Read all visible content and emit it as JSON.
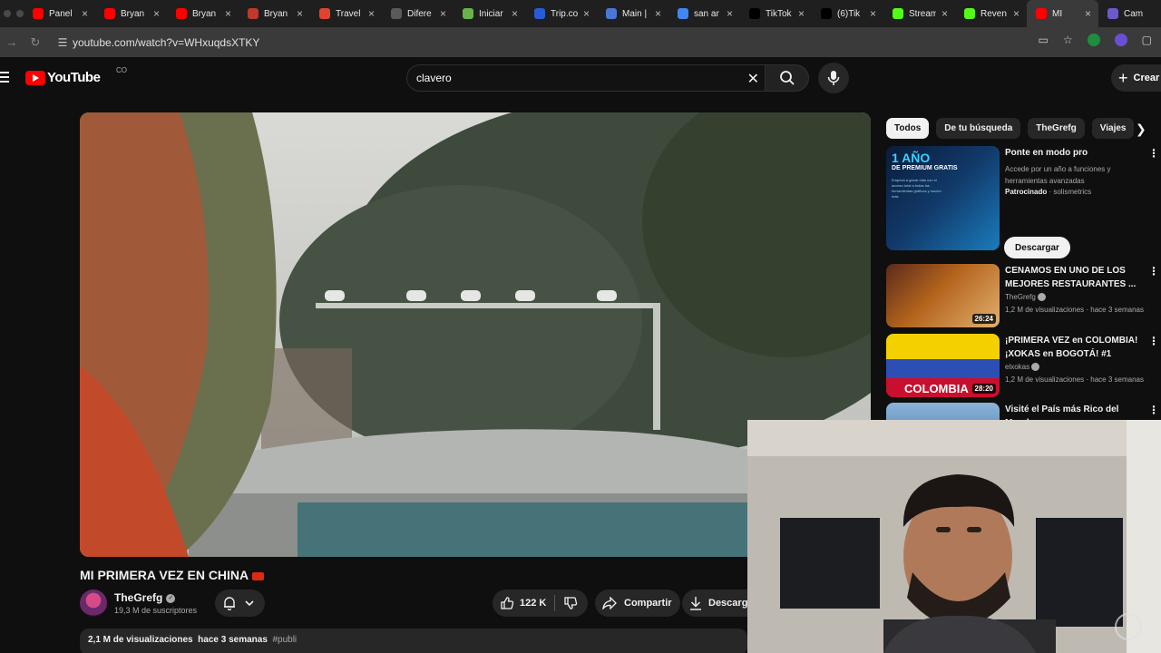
{
  "browser": {
    "tabs": [
      {
        "label": "Panel",
        "icon": "youtube-icon",
        "color": "#ff0000"
      },
      {
        "label": "Bryan",
        "icon": "youtube-icon",
        "color": "#ff0000"
      },
      {
        "label": "Bryan",
        "icon": "youtube-icon",
        "color": "#ff0000"
      },
      {
        "label": "Bryan",
        "icon": "analytics-icon",
        "color": "#c0392b"
      },
      {
        "label": "Travel",
        "icon": "g-icon",
        "color": "#e0442f"
      },
      {
        "label": "Difere",
        "icon": "openai-icon",
        "color": "#5a5a5a"
      },
      {
        "label": "Iniciar",
        "icon": "bag-icon",
        "color": "#6bb24c"
      },
      {
        "label": "Trip.co",
        "icon": "t-icon",
        "color": "#2a5bd7"
      },
      {
        "label": "Main |",
        "icon": "brain-icon",
        "color": "#4a76d6"
      },
      {
        "label": "san ar",
        "icon": "google-icon",
        "color": "#4285f4"
      },
      {
        "label": "TikTok",
        "icon": "tiktok-icon",
        "color": "#000000"
      },
      {
        "label": "(6)Tik",
        "icon": "tiktok-icon",
        "color": "#000000"
      },
      {
        "label": "Stream",
        "icon": "k-icon",
        "color": "#53fc18"
      },
      {
        "label": "Reven",
        "icon": "k-icon",
        "color": "#53fc18"
      },
      {
        "label": "MI",
        "icon": "youtube-icon",
        "color": "#ff0000"
      },
      {
        "label": "Cam",
        "icon": "circle-icon",
        "color": "#6a5acd"
      }
    ],
    "url": "youtube.com/watch?v=WHxuqdsXTKY"
  },
  "header": {
    "logo_text": "YouTube",
    "country": "CO",
    "search_value": "clavero",
    "create_label": "Crear"
  },
  "video": {
    "title": "MI PRIMERA VEZ EN CHINA",
    "channel": "TheGrefg",
    "subscribers": "19,3 M de suscriptores",
    "likes": "122 K",
    "share_label": "Compartir",
    "download_label": "Descargar",
    "views": "2,1 M de visualizaciones",
    "age": "hace 3 semanas",
    "hashtag": "#publi"
  },
  "sidebar": {
    "chips": [
      "Todos",
      "De tu búsqueda",
      "TheGrefg",
      "Viajes"
    ],
    "ad": {
      "thumb_big": "1 AÑO",
      "thumb_small": "DE PREMIUM GRATIS",
      "thumb_fine": "Empezá a ganar más con el acceso total a todas las herramientas gráficos y mucho más",
      "title": "Ponte en modo pro",
      "text": "Accede por un año a funciones y herramientas avanzadas",
      "sponsor_label": "Patrocinado",
      "sponsor": "solismetrics",
      "button": "Descargar"
    },
    "recs": [
      {
        "title": "CENAMOS EN UNO DE LOS MEJORES RESTAURANTES ...",
        "channel": "TheGrefg",
        "meta": "1,2 M de visualizaciones · hace 3 semanas",
        "duration": "26:24"
      },
      {
        "title": "¡PRIMERA VEZ en COLOMBIA! ¡XOKAS en BOGOTÁ! #1",
        "channel": "elxokas",
        "meta": "1,2 M de visualizaciones · hace 3 semanas",
        "duration": "28:20",
        "thumb_text": "COLOMBIA"
      },
      {
        "title": "Visité el País más Rico del Mundo",
        "channel": "",
        "meta": "",
        "duration": ""
      }
    ]
  },
  "colors": {
    "bg": "#0f0f0f",
    "chip": "#272727",
    "brand_red": "#ff0000",
    "text": "#f1f1f1",
    "muted": "#aaaaaa"
  }
}
